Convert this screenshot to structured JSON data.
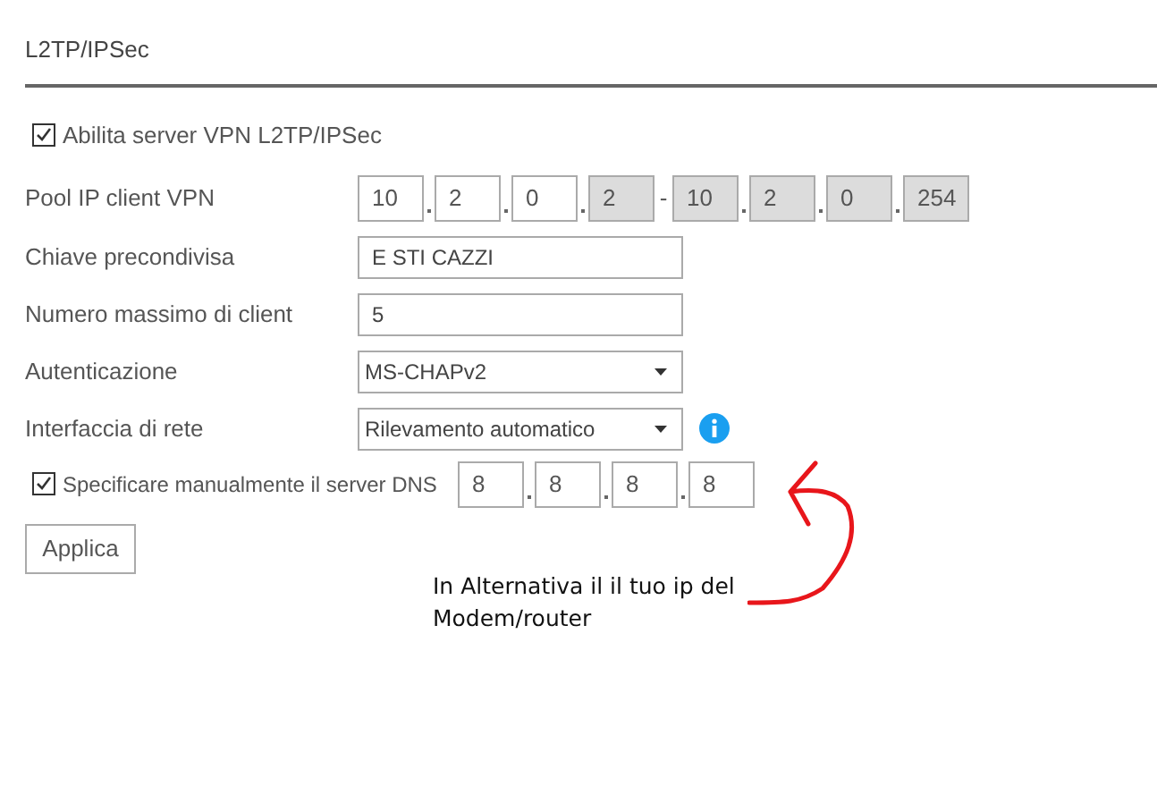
{
  "section_title": "L2TP/IPSec",
  "enable": {
    "label": "Abilita server VPN L2TP/IPSec",
    "checked": true
  },
  "pool": {
    "label": "Pool IP client VPN",
    "separator": "-",
    "start": [
      {
        "value": "10",
        "disabled": false
      },
      {
        "value": "2",
        "disabled": false
      },
      {
        "value": "0",
        "disabled": false
      },
      {
        "value": "2",
        "disabled": true
      }
    ],
    "end": [
      {
        "value": "10",
        "disabled": true
      },
      {
        "value": "2",
        "disabled": true
      },
      {
        "value": "0",
        "disabled": true
      },
      {
        "value": "254",
        "disabled": true
      }
    ]
  },
  "fields": [
    {
      "kind": "text",
      "label": "Chiave precondivisa",
      "value": "E STI CAZZI"
    },
    {
      "kind": "text",
      "label": "Numero massimo di client",
      "value": "5"
    },
    {
      "kind": "select",
      "label": "Autenticazione",
      "value": "MS-CHAPv2"
    },
    {
      "kind": "select",
      "label": "Interfaccia di rete",
      "value": "Rilevamento automatico",
      "info": true
    }
  ],
  "dns": {
    "label": "Specificare manualmente il server DNS",
    "checked": true,
    "octets": [
      "8",
      "8",
      "8",
      "8"
    ]
  },
  "apply_button": "Applica",
  "annotation": {
    "lines": [
      "In Alternativa il il tuo ip del",
      "Modem/router"
    ]
  }
}
